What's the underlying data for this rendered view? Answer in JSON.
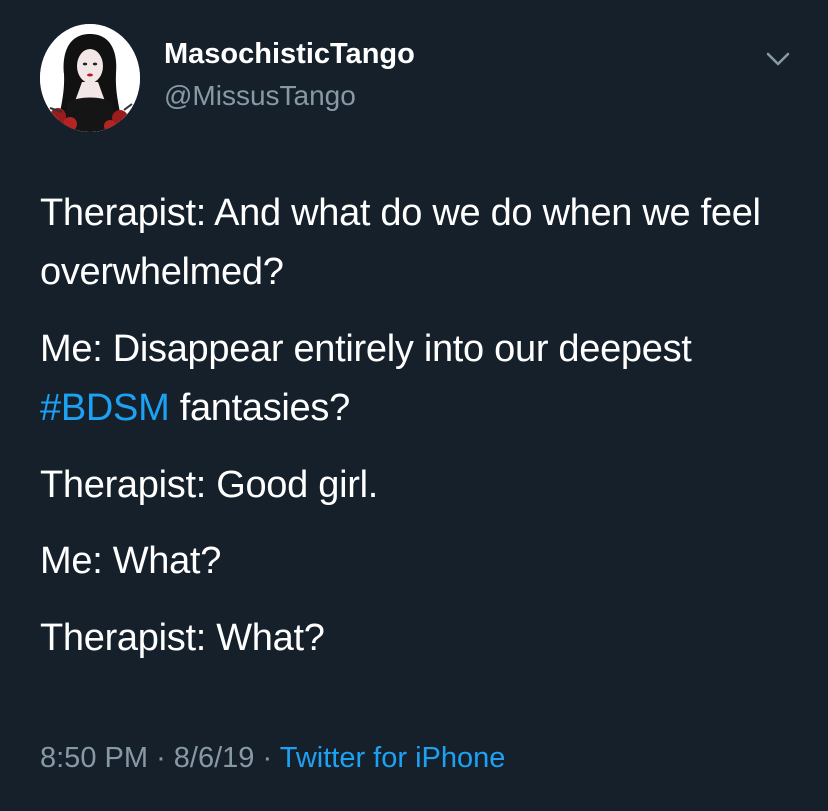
{
  "author": {
    "display_name": "MasochisticTango",
    "handle": "@MissusTango",
    "avatar_icon": "profile-portrait-icon"
  },
  "menu_icon": "chevron-down-icon",
  "tweet": {
    "lines": [
      {
        "text": "Therapist: And what do we do when we feel overwhelmed?"
      },
      {
        "before": "Me: Disappear entirely into our deepest ",
        "hashtag": "#BDSM",
        "after": " fantasies?"
      },
      {
        "text": "Therapist: Good girl."
      },
      {
        "text": "Me: What?"
      },
      {
        "text": "Therapist: What?"
      }
    ]
  },
  "meta": {
    "time": "8:50 PM",
    "separator": "·",
    "date": "8/6/19",
    "source": "Twitter for iPhone"
  },
  "colors": {
    "background": "#15202b",
    "text": "#ffffff",
    "secondary": "#8899a6",
    "accent": "#1da1f2"
  }
}
